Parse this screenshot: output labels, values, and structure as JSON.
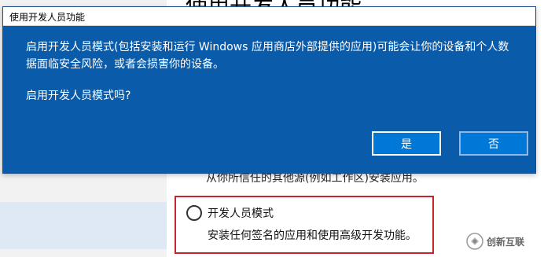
{
  "background": {
    "heading": "使用开发人员功能",
    "sideload_desc": "从你所信任的其他源(例如工作区)安装应用。",
    "dev_mode_option": {
      "label": "开发人员模式",
      "description": "安装任何签名的应用和使用高级开发功能。",
      "selected": false
    }
  },
  "dialog": {
    "title": "使用开发人员功能",
    "message": "启用开发人员模式(包括安装和运行 Windows 应用商店外部提供的应用)可能会让你的设备和个人数据面临安全风险，或者会损害你的设备。",
    "question": "启用开发人员模式吗?",
    "yes_label": "是",
    "no_label": "否"
  },
  "watermark": {
    "text": "创新互联"
  },
  "colors": {
    "dialog_bg": "#0a5cab",
    "button_bg": "#0078d7",
    "highlight_border": "#c4262e"
  }
}
